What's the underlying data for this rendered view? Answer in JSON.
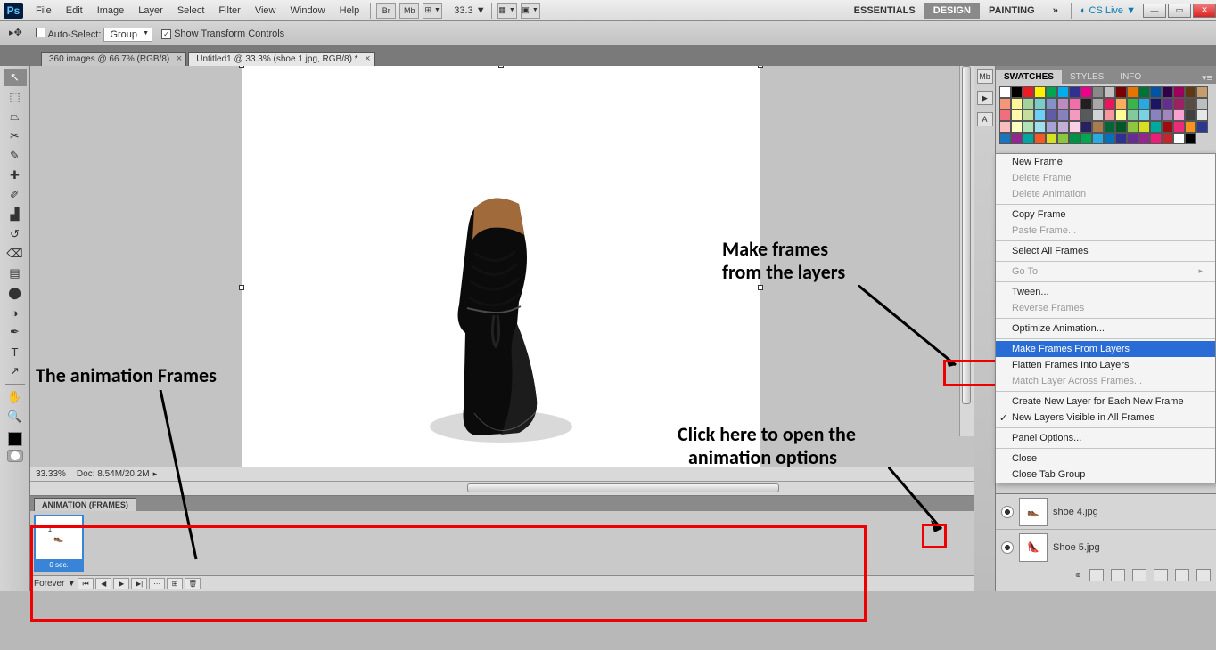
{
  "menubar": {
    "logo": "Ps",
    "items": [
      "File",
      "Edit",
      "Image",
      "Layer",
      "Select",
      "Filter",
      "View",
      "Window",
      "Help"
    ],
    "iconBtns": [
      "Br",
      "Mb"
    ],
    "zoom": "33.3",
    "workspaces": [
      "ESSENTIALS",
      "DESIGN",
      "PAINTING"
    ],
    "workspace_active": 1,
    "more_glyph": "»",
    "cslive": "CS Live"
  },
  "optbar": {
    "autoSelectLabel": "Auto-Select:",
    "autoSelectMode": "Group",
    "showTransformLabel": "Show Transform Controls",
    "showTransformChecked": true
  },
  "docTabs": [
    {
      "label": "360 images @ 66.7% (RGB/8)",
      "active": false
    },
    {
      "label": "Untitled1 @ 33.3% (shoe 1.jpg, RGB/8) *",
      "active": true
    }
  ],
  "tools": [
    "↖",
    "⬚",
    "◑",
    "✂",
    "✎",
    "✐",
    "⌫",
    "✦",
    "⟋",
    "⟋",
    "▟",
    "◒",
    "●",
    "🔍",
    "T",
    "↗",
    "✋",
    "🔎"
  ],
  "status": {
    "pct": "33.33%",
    "doc": "Doc: 8.54M/20.2M"
  },
  "animation": {
    "tabLabel": "ANIMATION (FRAMES)",
    "frame": {
      "num": "1",
      "delay": "0 sec."
    },
    "loop": "Forever"
  },
  "annotations": {
    "framesLabel": "The animation Frames",
    "makeLabel1": "Make frames",
    "makeLabel2": "from the layers",
    "clickLabel1": "Click here to open the",
    "clickLabel2": "animation options"
  },
  "rightTabs": {
    "tabs": [
      "SWATCHES",
      "STYLES",
      "INFO"
    ],
    "active": 0
  },
  "swatchColors": [
    "#ffffff",
    "#000000",
    "#ed1c24",
    "#fff200",
    "#00a651",
    "#00aeef",
    "#2e3192",
    "#ec008c",
    "#898989",
    "#c0c0c0",
    "#790000",
    "#e87400",
    "#007236",
    "#0054a6",
    "#32004b",
    "#9e005d",
    "#603913",
    "#c69c6d",
    "#f69679",
    "#fff799",
    "#a3d39c",
    "#7accc8",
    "#8393ca",
    "#bd8cbf",
    "#f06eaa",
    "#231f20",
    "#a8a8a8",
    "#ed145b",
    "#fbaf5d",
    "#39b54a",
    "#27aae1",
    "#1b1464",
    "#662d91",
    "#9e1f63",
    "#594a42",
    "#bcbec0",
    "#f26d7d",
    "#fff9ae",
    "#c4df9b",
    "#6dcff6",
    "#605ca8",
    "#8781bd",
    "#f49ac1",
    "#58595b",
    "#d1d3d4",
    "#f5989d",
    "#fdfd96",
    "#82ca9c",
    "#79d1e4",
    "#8882be",
    "#a186be",
    "#f8a1d0",
    "#404041",
    "#e6e7e8",
    "#f9bdbf",
    "#ffffc2",
    "#b2e2b5",
    "#a0e0ea",
    "#a8a2d3",
    "#c1afd5",
    "#fbcfe4",
    "#262262",
    "#a97c50",
    "#006838",
    "#005826",
    "#8dc63f",
    "#d7df23",
    "#00a99d",
    "#9e0b0f",
    "#ee2a7b",
    "#f7941d",
    "#2b3990",
    "#1c75bc",
    "#92278f",
    "#00a79d",
    "#f15a24",
    "#d6df22",
    "#8cc63f",
    "#009245",
    "#00a651",
    "#29abe2",
    "#0071bc",
    "#2e3192",
    "#662d91",
    "#93268f",
    "#ed1e79",
    "#c1272d",
    "#ffffff",
    "#000000"
  ],
  "flyout": {
    "groups": [
      [
        {
          "t": "New Frame"
        },
        {
          "t": "Delete Frame",
          "d": true
        },
        {
          "t": "Delete Animation",
          "d": true
        }
      ],
      [
        {
          "t": "Copy Frame"
        },
        {
          "t": "Paste Frame...",
          "d": true
        }
      ],
      [
        {
          "t": "Select All Frames"
        }
      ],
      [
        {
          "t": "Go To",
          "sub": true,
          "d": true
        }
      ],
      [
        {
          "t": "Tween..."
        },
        {
          "t": "Reverse Frames",
          "d": true
        }
      ],
      [
        {
          "t": "Optimize Animation..."
        }
      ],
      [
        {
          "t": "Make Frames From Layers",
          "sel": true
        },
        {
          "t": "Flatten Frames Into Layers"
        },
        {
          "t": "Match Layer Across Frames...",
          "d": true
        }
      ],
      [
        {
          "t": "Create New Layer for Each New Frame"
        },
        {
          "t": "New Layers Visible in All Frames",
          "chk": true
        }
      ],
      [
        {
          "t": "Panel Options..."
        }
      ],
      [
        {
          "t": "Close"
        },
        {
          "t": "Close Tab Group"
        }
      ]
    ]
  },
  "layers": [
    {
      "name": "shoe 4.jpg"
    },
    {
      "name": "Shoe 5.jpg"
    }
  ]
}
